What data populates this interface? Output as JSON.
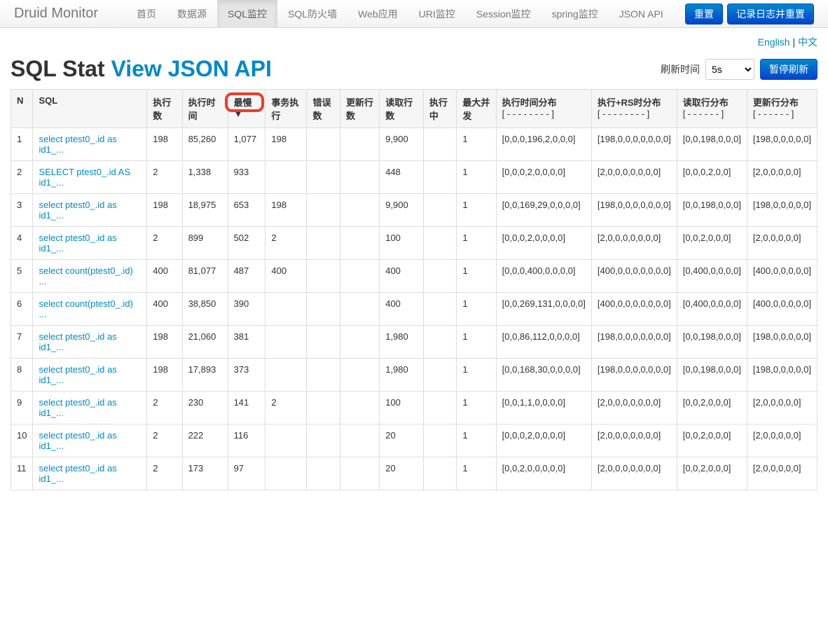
{
  "navbar": {
    "brand": "Druid Monitor",
    "items": [
      "首页",
      "数据源",
      "SQL监控",
      "SQL防火墙",
      "Web应用",
      "URI监控",
      "Session监控",
      "spring监控",
      "JSON API"
    ],
    "active_index": 2,
    "reset_btn": "重置",
    "log_reset_btn": "记录日志并重置"
  },
  "lang": {
    "english": "English",
    "sep": " | ",
    "chinese": "中文"
  },
  "page": {
    "title": "SQL Stat ",
    "api_link": "View JSON API",
    "refresh_label": "刷新时间",
    "refresh_value": "5s",
    "pause_btn": "暂停刷新"
  },
  "columns": [
    {
      "label": "N"
    },
    {
      "label": "SQL"
    },
    {
      "label": "执行数"
    },
    {
      "label": "执行时间"
    },
    {
      "label": "最慢▼"
    },
    {
      "label": "事务执行"
    },
    {
      "label": "错误数"
    },
    {
      "label": "更新行数"
    },
    {
      "label": "读取行数"
    },
    {
      "label": "执行中"
    },
    {
      "label": "最大并发"
    },
    {
      "label": "执行时间分布",
      "sub": "[ - - - - - - - - ]"
    },
    {
      "label": "执行+RS时分布",
      "sub": "[ - - - - - - - - ]"
    },
    {
      "label": "读取行分布",
      "sub": "[ - - - - - - ]"
    },
    {
      "label": "更新行分布",
      "sub": "[ - - - - - - ]"
    }
  ],
  "rows": [
    {
      "n": "1",
      "sql": "select ptest0_.id as id1_...",
      "exec": "198",
      "time": "85,260",
      "slow": "1,077",
      "txn": "198",
      "err": "",
      "upd": "",
      "read": "9,900",
      "running": "",
      "conc": "1",
      "d1": "[0,0,0,196,2,0,0,0]",
      "d2": "[198,0,0,0,0,0,0,0]",
      "d3": "[0,0,198,0,0,0]",
      "d4": "[198,0,0,0,0,0]"
    },
    {
      "n": "2",
      "sql": "SELECT ptest0_.id AS id1_...",
      "exec": "2",
      "time": "1,338",
      "slow": "933",
      "txn": "",
      "err": "",
      "upd": "",
      "read": "448",
      "running": "",
      "conc": "1",
      "d1": "[0,0,0,2,0,0,0,0]",
      "d2": "[2,0,0,0,0,0,0,0]",
      "d3": "[0,0,0,2,0,0]",
      "d4": "[2,0,0,0,0,0]"
    },
    {
      "n": "3",
      "sql": "select ptest0_.id as id1_...",
      "exec": "198",
      "time": "18,975",
      "slow": "653",
      "txn": "198",
      "err": "",
      "upd": "",
      "read": "9,900",
      "running": "",
      "conc": "1",
      "d1": "[0,0,169,29,0,0,0,0]",
      "d2": "[198,0,0,0,0,0,0,0]",
      "d3": "[0,0,198,0,0,0]",
      "d4": "[198,0,0,0,0,0]"
    },
    {
      "n": "4",
      "sql": "select ptest0_.id as id1_...",
      "exec": "2",
      "time": "899",
      "slow": "502",
      "txn": "2",
      "err": "",
      "upd": "",
      "read": "100",
      "running": "",
      "conc": "1",
      "d1": "[0,0,0,2,0,0,0,0]",
      "d2": "[2,0,0,0,0,0,0,0]",
      "d3": "[0,0,2,0,0,0]",
      "d4": "[2,0,0,0,0,0]"
    },
    {
      "n": "5",
      "sql": "select count(ptest0_.id) ...",
      "exec": "400",
      "time": "81,077",
      "slow": "487",
      "txn": "400",
      "err": "",
      "upd": "",
      "read": "400",
      "running": "",
      "conc": "1",
      "d1": "[0,0,0,400,0,0,0,0]",
      "d2": "[400,0,0,0,0,0,0,0]",
      "d3": "[0,400,0,0,0,0]",
      "d4": "[400,0,0,0,0,0]"
    },
    {
      "n": "6",
      "sql": "select count(ptest0_.id) ...",
      "exec": "400",
      "time": "38,850",
      "slow": "390",
      "txn": "",
      "err": "",
      "upd": "",
      "read": "400",
      "running": "",
      "conc": "1",
      "d1": "[0,0,269,131,0,0,0,0]",
      "d2": "[400,0,0,0,0,0,0,0]",
      "d3": "[0,400,0,0,0,0]",
      "d4": "[400,0,0,0,0,0]"
    },
    {
      "n": "7",
      "sql": "select ptest0_.id as id1_...",
      "exec": "198",
      "time": "21,060",
      "slow": "381",
      "txn": "",
      "err": "",
      "upd": "",
      "read": "1,980",
      "running": "",
      "conc": "1",
      "d1": "[0,0,86,112,0,0,0,0]",
      "d2": "[198,0,0,0,0,0,0,0]",
      "d3": "[0,0,198,0,0,0]",
      "d4": "[198,0,0,0,0,0]"
    },
    {
      "n": "8",
      "sql": "select ptest0_.id as id1_...",
      "exec": "198",
      "time": "17,893",
      "slow": "373",
      "txn": "",
      "err": "",
      "upd": "",
      "read": "1,980",
      "running": "",
      "conc": "1",
      "d1": "[0,0,168,30,0,0,0,0]",
      "d2": "[198,0,0,0,0,0,0,0]",
      "d3": "[0,0,198,0,0,0]",
      "d4": "[198,0,0,0,0,0]"
    },
    {
      "n": "9",
      "sql": "select ptest0_.id as id1_...",
      "exec": "2",
      "time": "230",
      "slow": "141",
      "txn": "2",
      "err": "",
      "upd": "",
      "read": "100",
      "running": "",
      "conc": "1",
      "d1": "[0,0,1,1,0,0,0,0]",
      "d2": "[2,0,0,0,0,0,0,0]",
      "d3": "[0,0,2,0,0,0]",
      "d4": "[2,0,0,0,0,0]"
    },
    {
      "n": "10",
      "sql": "select ptest0_.id as id1_...",
      "exec": "2",
      "time": "222",
      "slow": "116",
      "txn": "",
      "err": "",
      "upd": "",
      "read": "20",
      "running": "",
      "conc": "1",
      "d1": "[0,0,0,2,0,0,0,0]",
      "d2": "[2,0,0,0,0,0,0,0]",
      "d3": "[0,0,2,0,0,0]",
      "d4": "[2,0,0,0,0,0]"
    },
    {
      "n": "11",
      "sql": "select ptest0_.id as id1_...",
      "exec": "2",
      "time": "173",
      "slow": "97",
      "txn": "",
      "err": "",
      "upd": "",
      "read": "20",
      "running": "",
      "conc": "1",
      "d1": "[0,0,2,0,0,0,0,0]",
      "d2": "[2,0,0,0,0,0,0,0]",
      "d3": "[0,0,2,0,0,0]",
      "d4": "[2,0,0,0,0,0]"
    }
  ]
}
